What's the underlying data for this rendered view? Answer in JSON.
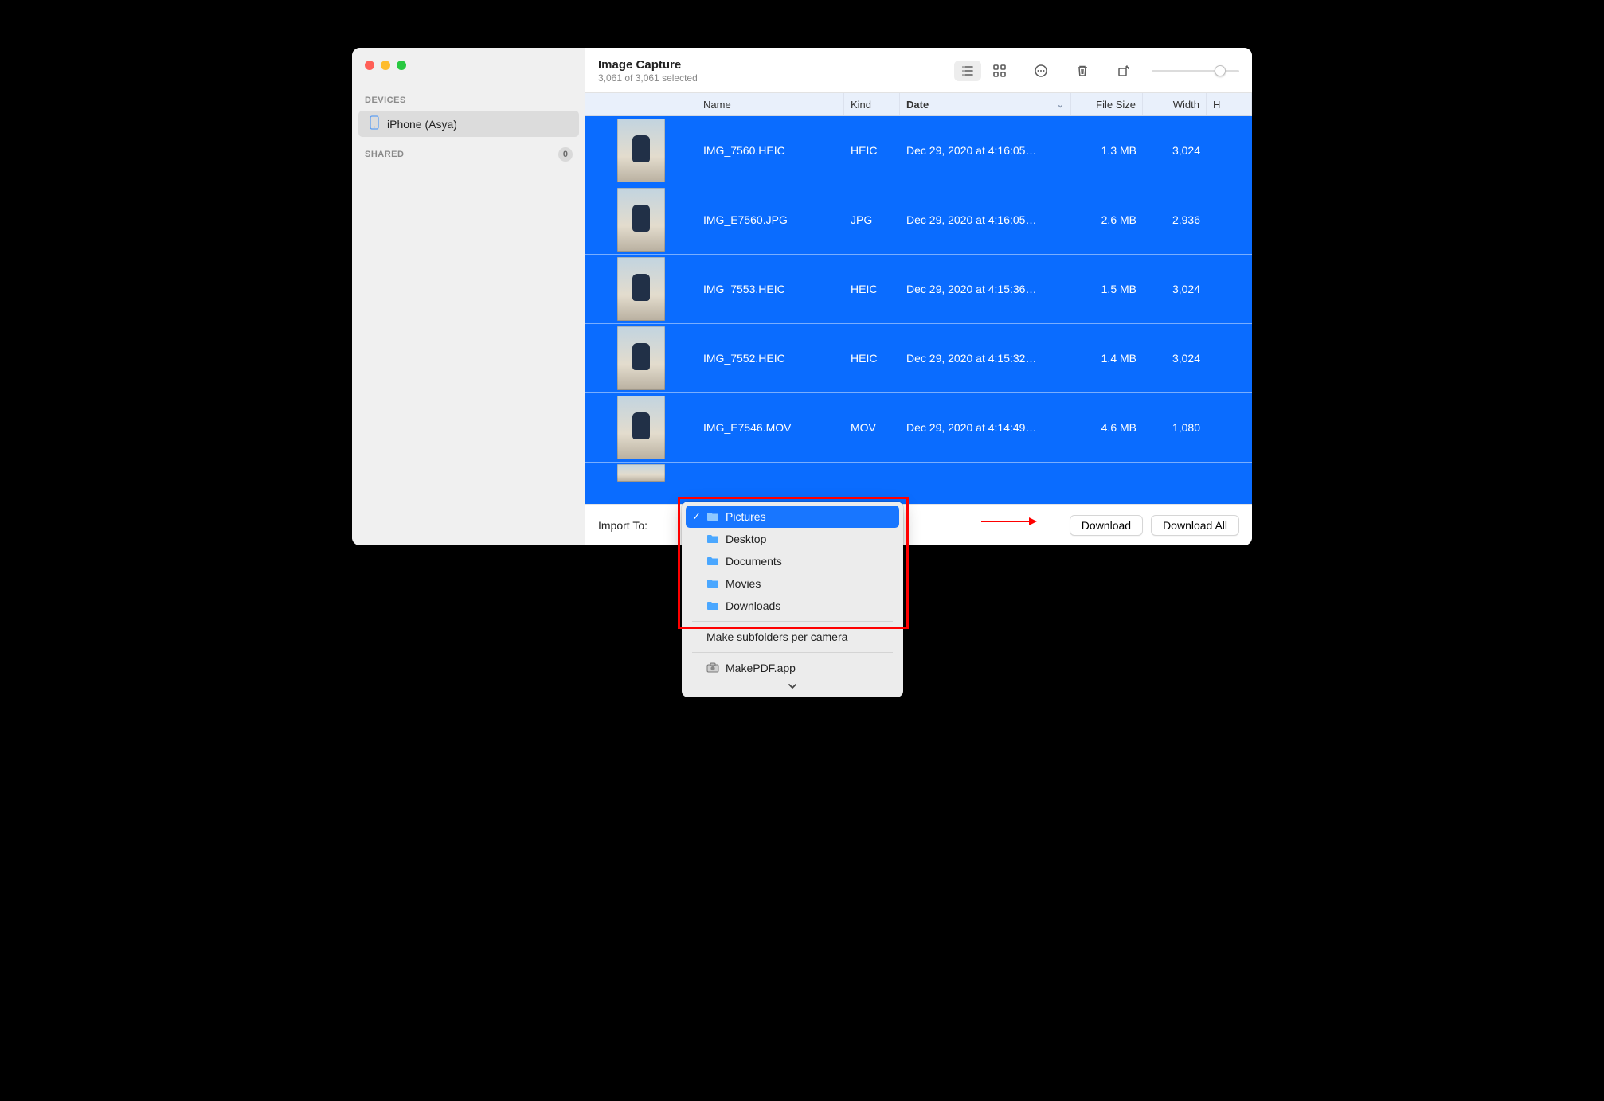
{
  "header": {
    "title": "Image Capture",
    "subtitle": "3,061 of 3,061 selected"
  },
  "sidebar": {
    "sections": {
      "devices_label": "DEVICES",
      "shared_label": "SHARED",
      "shared_count": "0"
    },
    "device": {
      "name": "iPhone (Asya)"
    }
  },
  "columns": {
    "name": "Name",
    "kind": "Kind",
    "date": "Date",
    "size": "File Size",
    "width": "Width",
    "h": "H"
  },
  "rows": [
    {
      "name": "IMG_7560.HEIC",
      "kind": "HEIC",
      "date": "Dec 29, 2020 at 4:16:05…",
      "size": "1.3 MB",
      "width": "3,024"
    },
    {
      "name": "IMG_E7560.JPG",
      "kind": "JPG",
      "date": "Dec 29, 2020 at 4:16:05…",
      "size": "2.6 MB",
      "width": "2,936"
    },
    {
      "name": "IMG_7553.HEIC",
      "kind": "HEIC",
      "date": "Dec 29, 2020 at 4:15:36…",
      "size": "1.5 MB",
      "width": "3,024"
    },
    {
      "name": "IMG_7552.HEIC",
      "kind": "HEIC",
      "date": "Dec 29, 2020 at 4:15:32…",
      "size": "1.4 MB",
      "width": "3,024"
    },
    {
      "name": "IMG_E7546.MOV",
      "kind": "MOV",
      "date": "Dec 29, 2020 at 4:14:49…",
      "size": "4.6 MB",
      "width": "1,080"
    }
  ],
  "footer": {
    "import_to_label": "Import To:",
    "download_label": "Download",
    "download_all_label": "Download All"
  },
  "popup": {
    "items": [
      "Pictures",
      "Desktop",
      "Documents",
      "Movies",
      "Downloads"
    ],
    "selected": "Pictures",
    "make_subfolders": "Make subfolders per camera",
    "app": "MakePDF.app"
  }
}
